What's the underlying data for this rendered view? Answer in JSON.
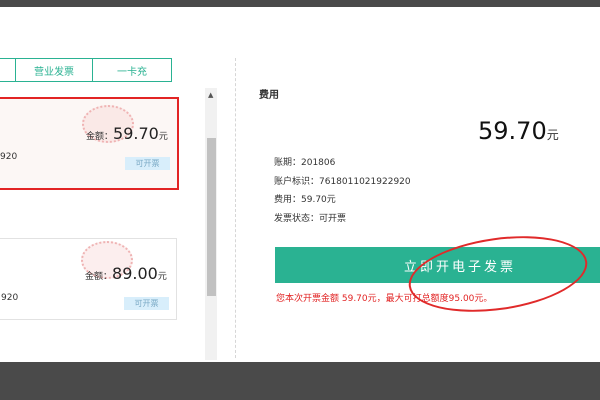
{
  "tabs": [
    {
      "label": ""
    },
    {
      "label": "营业发票"
    },
    {
      "label": "一卡充"
    }
  ],
  "bills": [
    {
      "amount_label": "金额：",
      "amount": "59.70",
      "unit": "元",
      "account_fragment": "920",
      "status": "可开票"
    },
    {
      "amount_label": "金额：",
      "amount": "89.00",
      "unit": "元",
      "account_fragment": "920",
      "status": "可开票"
    }
  ],
  "detail": {
    "title": "费用",
    "amount": "59.70",
    "amount_unit": "元",
    "period": "账期：201806",
    "account_id": "账户标识：7618011021922920",
    "fee": "费用：59.70元",
    "invoice_status": "发票状态：可开票",
    "issue_button": "立即开电子发票",
    "note": "您本次开票金额 59.70元，最大可打总额度95.00元。"
  },
  "colors": {
    "accent": "#2ab292",
    "highlight_red": "#e22424",
    "badge_bg": "#d8eefb"
  }
}
